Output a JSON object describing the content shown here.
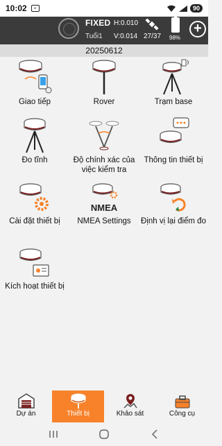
{
  "status_bar": {
    "time": "10:02",
    "battery": "90"
  },
  "gnss": {
    "fix_status": "FIXED",
    "age": "Tuổi1",
    "h_accuracy": "H:0.010",
    "v_accuracy": "V:0.014",
    "satellites": "27/37",
    "receiver_battery": "98%"
  },
  "project": {
    "name": "20250612"
  },
  "tiles": [
    {
      "label": "Giao tiếp",
      "icon": "receiver-phone-icon"
    },
    {
      "label": "Rover",
      "icon": "rover-pole-icon"
    },
    {
      "label": "Trạm base",
      "icon": "base-station-icon"
    },
    {
      "label": "Đo tĩnh",
      "icon": "static-tripod-icon"
    },
    {
      "label": "Độ chính xác của việc kiểm tra",
      "icon": "tilt-accuracy-icon"
    },
    {
      "label": "Thông tin thiết bị",
      "icon": "device-info-icon"
    },
    {
      "label": "Cài đặt thiết bị",
      "icon": "device-settings-icon"
    },
    {
      "label": "NMEA Settings",
      "icon": "nmea-settings-icon",
      "badge": "NMEA"
    },
    {
      "label": "Định vị lại điểm đo",
      "icon": "relocate-point-icon"
    },
    {
      "label": "Kích hoạt thiết bị",
      "icon": "device-activation-icon"
    }
  ],
  "bottom_nav": [
    {
      "label": "Dự án",
      "icon": "project-icon",
      "active": false
    },
    {
      "label": "Thiết bị",
      "icon": "device-icon",
      "active": true
    },
    {
      "label": "Khảo sát",
      "icon": "survey-icon",
      "active": false
    },
    {
      "label": "Công cụ",
      "icon": "tools-icon",
      "active": false
    }
  ],
  "colors": {
    "accent": "#f7822a",
    "header": "#3b3b3b",
    "receiver_band": "#7a1f1f"
  }
}
